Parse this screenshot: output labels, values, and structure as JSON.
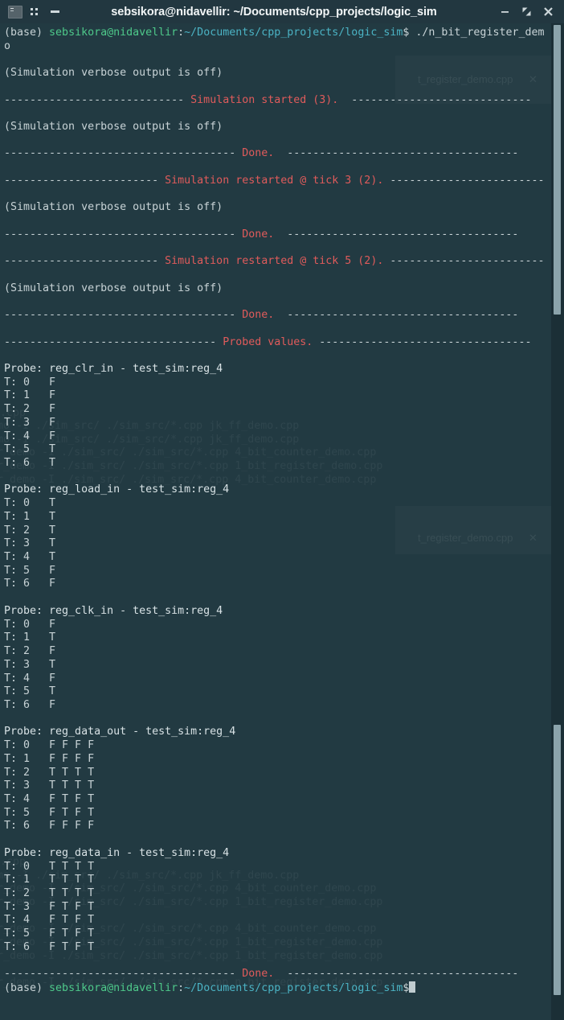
{
  "window": {
    "title": "sebsikora@nidavellir: ~/Documents/cpp_projects/logic_sim",
    "app_icon": "terminal-icon",
    "menu_icon": "grid-dots-icon",
    "dash_icon": "dash-icon",
    "minimize_label": "–",
    "maximize_label": "❐",
    "close_label": "✕",
    "titlebar_bg": "#223740",
    "terminal_bg": "#223a42"
  },
  "colors": {
    "prompt_user": "#4ec98a",
    "prompt_path": "#4bb3c4",
    "banner": "#e05b5b",
    "text": "#c8d3d6",
    "scrollbar_thumb": "#8ba3ab"
  },
  "prompt": {
    "env": "(base) ",
    "user_host": "sebsikora@nidavellir",
    "colon": ":",
    "path": "~/Documents/cpp_projects/logic_sim",
    "dollar": "$",
    "command": " ./n_bit_register_dem",
    "command_wrap": "o",
    "final_command": ""
  },
  "terminal": {
    "verbose_off": "(Simulation verbose output is off)",
    "banner_started": {
      "left": "---------------------------- ",
      "text": "Simulation started (3).",
      "right": "  ----------------------------"
    },
    "banner_done_1": {
      "left": "------------------------------------ ",
      "text": "Done.",
      "right": "  ------------------------------------"
    },
    "banner_restart_3": {
      "left": "------------------------ ",
      "text": "Simulation restarted @ tick 3 (2).",
      "right": " ------------------------"
    },
    "banner_done_2": {
      "left": "------------------------------------ ",
      "text": "Done.",
      "right": "  ------------------------------------"
    },
    "banner_restart_5": {
      "left": "------------------------ ",
      "text": "Simulation restarted @ tick 5 (2).",
      "right": " ------------------------"
    },
    "banner_done_3": {
      "left": "------------------------------------ ",
      "text": "Done.",
      "right": "  ------------------------------------"
    },
    "banner_probed": {
      "left": "--------------------------------- ",
      "text": "Probed values.",
      "right": " ---------------------------------"
    },
    "banner_done_final": {
      "left": "------------------------------------ ",
      "text": "Done.",
      "right": "  ------------------------------------"
    }
  },
  "probes": [
    {
      "header": "Probe: reg_clr_in - test_sim:reg_4",
      "rows": [
        "T: 0   F",
        "T: 1   F",
        "T: 2   F",
        "T: 3   F",
        "T: 4   F",
        "T: 5   T",
        "T: 6   T"
      ]
    },
    {
      "header": "Probe: reg_load_in - test_sim:reg_4",
      "rows": [
        "T: 0   T",
        "T: 1   T",
        "T: 2   T",
        "T: 3   T",
        "T: 4   T",
        "T: 5   F",
        "T: 6   F"
      ]
    },
    {
      "header": "Probe: reg_clk_in - test_sim:reg_4",
      "rows": [
        "T: 0   F",
        "T: 1   T",
        "T: 2   F",
        "T: 3   T",
        "T: 4   F",
        "T: 5   T",
        "T: 6   F"
      ]
    },
    {
      "header": "Probe: reg_data_out - test_sim:reg_4",
      "rows": [
        "T: 0   F F F F",
        "T: 1   F F F F",
        "T: 2   T T T T",
        "T: 3   T T T T",
        "T: 4   F T F T",
        "T: 5   F T F T",
        "T: 6   F F F F"
      ]
    },
    {
      "header": "Probe: reg_data_in - test_sim:reg_4",
      "rows": [
        "T: 0   T T T T",
        "T: 1   T T T T",
        "T: 2   T T T T",
        "T: 3   F T F T",
        "T: 4   F T F T",
        "T: 5   F T F T",
        "T: 6   F T F T"
      ]
    }
  ],
  "ghost": {
    "tab_label": "t_register_demo.cpp",
    "tab_close": "✕",
    "lines": [
      ".cpp",
      "_demo -I ./sim_src/ ./sim_src/*.cpp jk_ff_demo.cpp",
      "_demo -I ./sim_src/ ./sim_src/*.cpp jk_ff_demo.cpp",
      "er_demo -I ./sim_src/ ./sim_src/*.cpp 4_bit_counter_demo.cpp",
      "er_demo -I ./sim_src/ ./sim_src/*.cpp 1_bit_register_demo.cpp",
      "er_demo -I ./sim_src/ ./sim_src/*.cpp 4_bit_counter_demo.cpp",
      ".cpp",
      "_demo -I ./sim_src/ ./sim_src/*.cpp jk_ff_demo.cpp",
      "er_demo -I ./sim_src/ ./sim_src/*.cpp 4_bit_counter_demo.cpp",
      "er_demo -I ./sim_src/ ./sim_src/*.cpp 1_bit_register_demo.cpp",
      "er_demo -I ./sim_src/ ./sim_src/*.cpp 4_bit_counter_demo.cpp",
      "er_demo -I ./sim_src/ ./sim_src/*.cpp 1_bit_register_demo.cpp",
      "er_demo -I ./sim_src/ ./sim_src/*.cpp 1_bit_register_demo.cpp",
      "er_demo -I ./sim_src/ ./sim_src/*.cpp n_bit_register_demo.cpp"
    ]
  }
}
